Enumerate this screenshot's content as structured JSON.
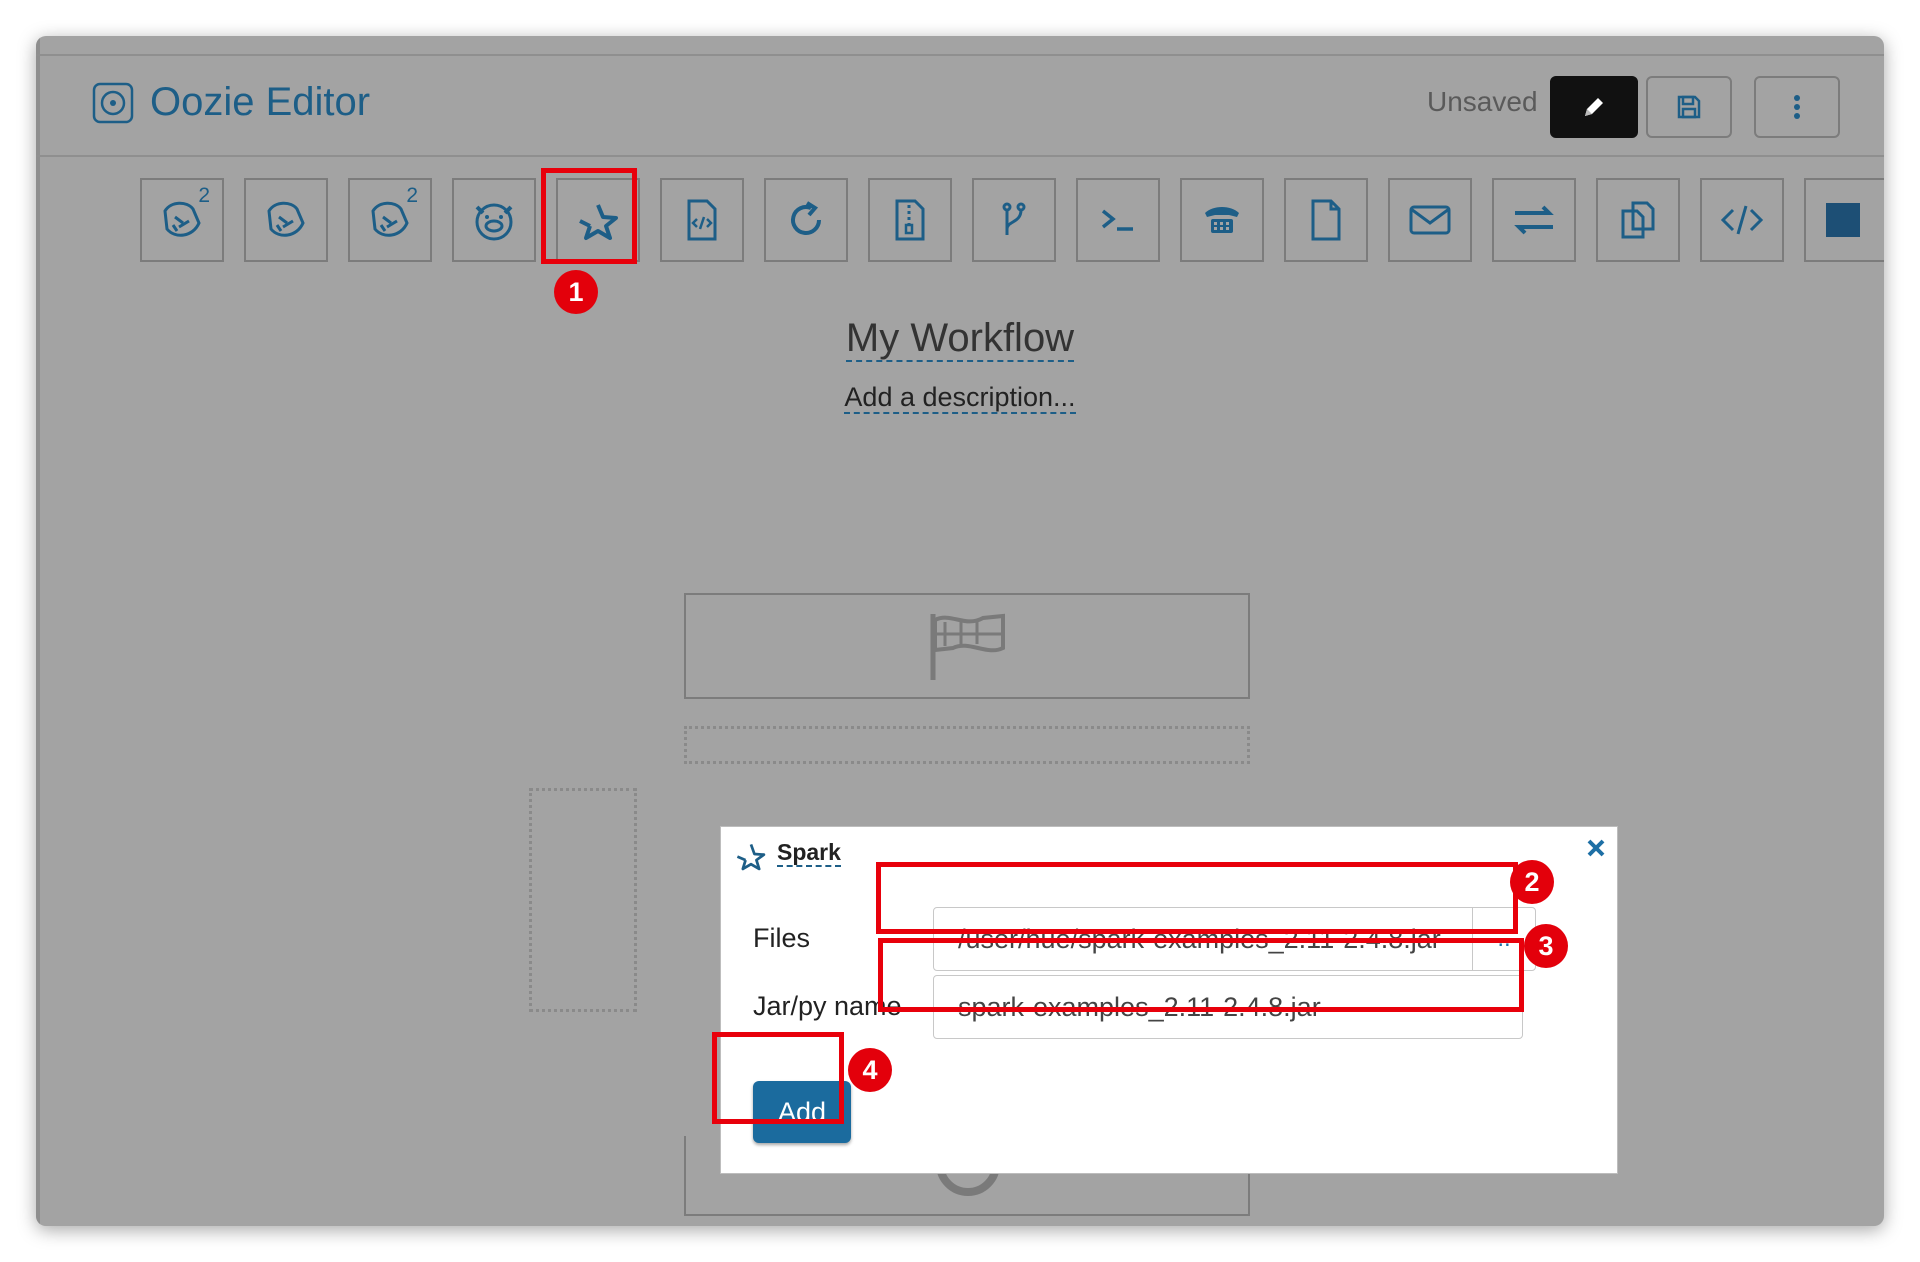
{
  "app": {
    "title": "Oozie Editor",
    "status": "Unsaved"
  },
  "header_buttons": [
    {
      "name": "edit",
      "icon": "pencil-icon"
    },
    {
      "name": "save",
      "icon": "save-icon"
    },
    {
      "name": "more",
      "icon": "more-vertical-icon"
    }
  ],
  "toolbar": [
    {
      "icon": "hive2-icon",
      "sup": "2"
    },
    {
      "icon": "hive-icon",
      "sup": ""
    },
    {
      "icon": "hive2-server-icon",
      "sup": "2"
    },
    {
      "icon": "pig-icon",
      "sup": ""
    },
    {
      "icon": "spark-icon",
      "sup": ""
    },
    {
      "icon": "java-file-icon",
      "sup": ""
    },
    {
      "icon": "sync-icon",
      "sup": ""
    },
    {
      "icon": "archive-file-icon",
      "sup": ""
    },
    {
      "icon": "fork-icon",
      "sup": ""
    },
    {
      "icon": "shell-icon",
      "sup": ""
    },
    {
      "icon": "ssh-icon",
      "sup": ""
    },
    {
      "icon": "file-icon",
      "sup": ""
    },
    {
      "icon": "email-icon",
      "sup": ""
    },
    {
      "icon": "exchange-icon",
      "sup": ""
    },
    {
      "icon": "copy-icon",
      "sup": ""
    },
    {
      "icon": "code-icon",
      "sup": ""
    },
    {
      "icon": "stop-icon",
      "sup": ""
    }
  ],
  "workflow": {
    "title": "My Workflow",
    "description": "Add a description..."
  },
  "dialog": {
    "title": "Spark",
    "files_label": "Files",
    "files_value": "/user/hue/spark-examples_2.11-2.4.8.jar",
    "browse_label": "..",
    "jar_label": "Jar/py name",
    "jar_value": "spark-examples_2.11-2.4.8.jar",
    "add_label": "Add"
  },
  "callouts": [
    "1",
    "2",
    "3",
    "4"
  ],
  "colors": {
    "accent": "#1d5e87",
    "callout": "#e3000b",
    "primary_button": "#1b6b9e",
    "overlay": "#a3a3a3"
  }
}
